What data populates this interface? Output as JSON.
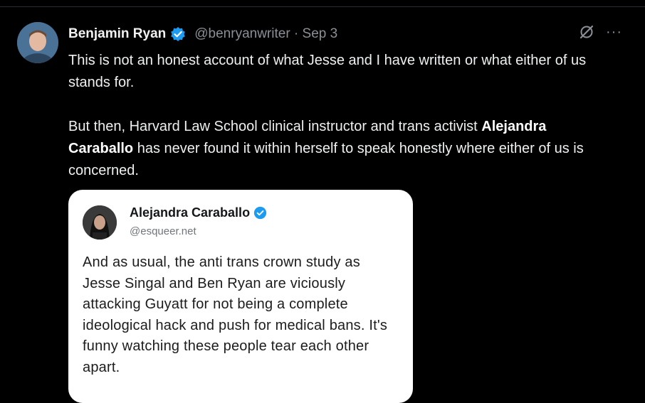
{
  "tweet": {
    "author_name": "Benjamin Ryan",
    "author_handle_date": "@benryanwriter · Sep 3",
    "paragraph1": "This is not an honest account of what Jesse and I have written or what either of us stands for.",
    "paragraph2_start": "But then, Harvard Law School clinical instructor and trans activist ",
    "paragraph2_bold": "Alejandra Caraballo",
    "paragraph2_end": " has never found it within herself to speak honestly where either of us is concerned.",
    "more_label": "···",
    "icons": [
      "verified-badge-icon",
      "grok-icon",
      "more-icon"
    ]
  },
  "quote": {
    "name": "Alejandra Caraballo",
    "handle": "@esqueer.net",
    "text": "And as usual, the anti trans crown study as Jesse Singal and Ben Ryan are viciously attacking Guyatt for not being a complete ideological hack and push for medical bans. It's funny watching these people tear each other apart."
  },
  "colors": {
    "background": "#000000",
    "verified_blue": "#1d9bf0",
    "quote_card": "#ffffff",
    "muted": "#8b9096"
  }
}
